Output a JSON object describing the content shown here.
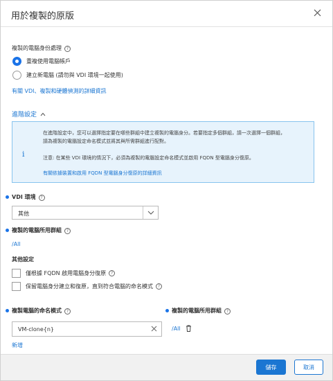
{
  "dialog": {
    "title": "用於複製的原版"
  },
  "identity": {
    "label": "複製的電腦身份處理",
    "options": [
      {
        "label": "重複使用電腦帳戶",
        "selected": true
      },
      {
        "label": "建立新電腦 (請勿與 VDI 環境一起使用)",
        "selected": false
      }
    ],
    "more_info_link": "有關 VDI、複製和硬體偵測的詳細資訊"
  },
  "advanced": {
    "toggle_label": "進階設定",
    "info": {
      "line1": "在進階設定中，您可以選擇指定要在哪些群組中建立複製的電腦身分。若要指定多個群組，請一次選擇一個群組，",
      "line2": "請為複製的電腦設定命名模式並將其與所需群組進行配對。",
      "line3": "注意: 在某些 VDI 環境的情況下，必須為複製的電腦設定命名模式並啟用 FQDN 型電腦身分復原。",
      "link": "有關依據裝置和啟用 FQDN 型電腦身分復原的詳細資訊"
    }
  },
  "vdi": {
    "label": "VDI 環境",
    "selected": "其他"
  },
  "cloned_group": {
    "label": "複製的電腦所用群組",
    "value": "/All"
  },
  "other_settings": {
    "label": "其他設定",
    "checkboxes": [
      {
        "label": "僅根據 FQDN 啟用電腦身分復原",
        "checked": false
      },
      {
        "label": "保留電腦身分建立和復原，直到符合電腦的命名模式",
        "checked": false
      }
    ]
  },
  "naming": {
    "label": "複製電腦的命名模式",
    "value": "VM-clone{n}",
    "add_link": "新增"
  },
  "naming_group": {
    "label": "複製的電腦所用群組",
    "value": "/All"
  },
  "footer": {
    "save_label": "儲存",
    "cancel_label": "取消"
  },
  "colors": {
    "accent": "#1b76d2",
    "info_bg": "#e7f3fc",
    "info_border": "#87c3ee"
  }
}
